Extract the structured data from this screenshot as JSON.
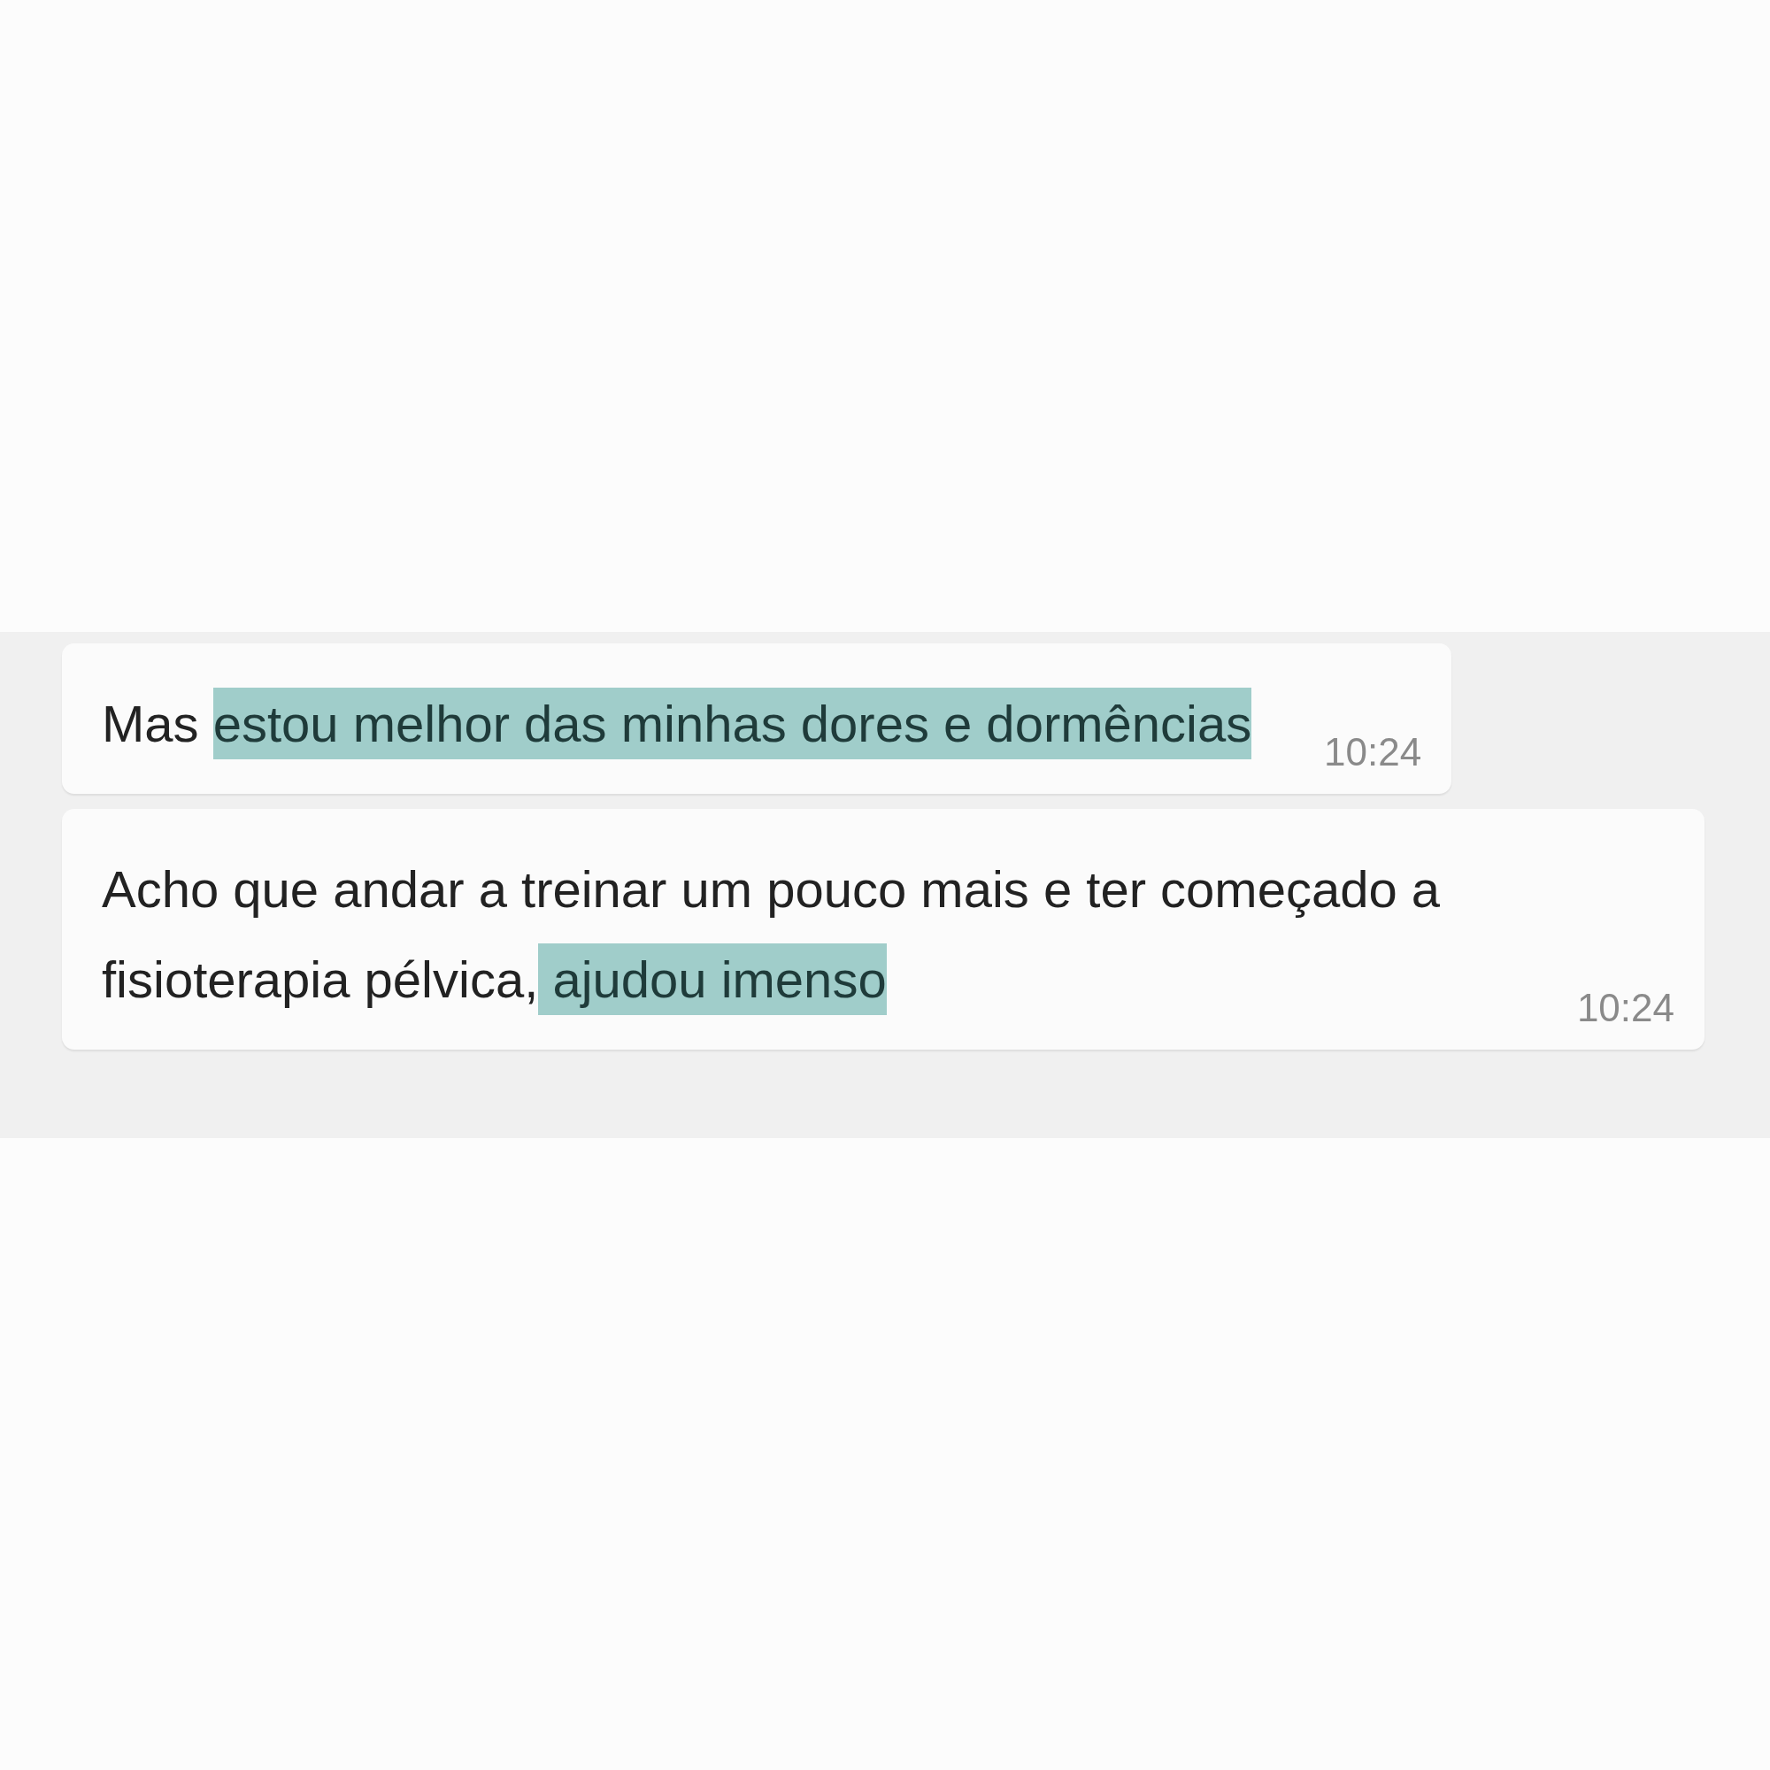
{
  "messages": [
    {
      "segments": [
        {
          "text": "Mas ",
          "highlighted": false
        },
        {
          "text": "estou melhor das minhas dores e dormências",
          "highlighted": true
        }
      ],
      "time": "10:24"
    },
    {
      "segments": [
        {
          "text": "Acho que andar a treinar um pouco mais e ter começado a fisioterapia pélvica,",
          "highlighted": false
        },
        {
          "text": " ajudou imenso",
          "highlighted": true
        }
      ],
      "time": "10:24"
    }
  ]
}
